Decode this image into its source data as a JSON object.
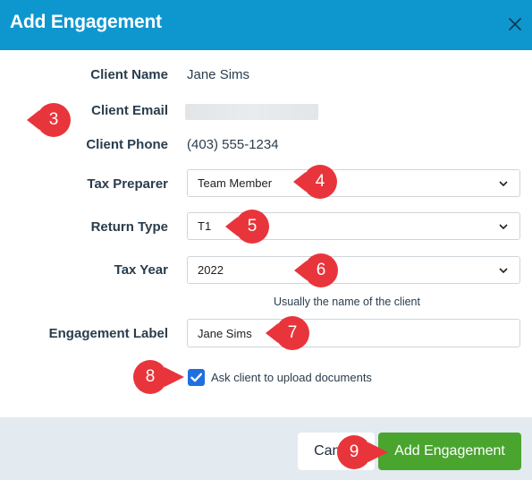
{
  "dialog": {
    "title": "Add Engagement"
  },
  "fields": {
    "client_name_label": "Client Name",
    "client_name_value": "Jane Sims",
    "client_email_label": "Client Email",
    "client_phone_label": "Client Phone",
    "client_phone_value": "(403) 555-1234",
    "tax_preparer_label": "Tax Preparer",
    "tax_preparer_value": "Team Member",
    "return_type_label": "Return Type",
    "return_type_value": "T1",
    "tax_year_label": "Tax Year",
    "tax_year_value": "2022",
    "engagement_hint": "Usually the name of the client",
    "engagement_label_label": "Engagement Label",
    "engagement_label_value": "Jane Sims",
    "upload_checkbox_label": "Ask client to upload documents",
    "upload_checkbox_checked": true
  },
  "footer": {
    "cancel_label": "Cancel",
    "submit_label": "Add Engagement"
  },
  "callouts": [
    "3",
    "4",
    "5",
    "6",
    "7",
    "8",
    "9"
  ],
  "colors": {
    "header": "#0e97cf",
    "primary_button": "#4aa52e",
    "checkbox": "#1f6fe0",
    "callout": "#e8353b",
    "footer": "#e3eaf0"
  },
  "icons": {
    "close": "close-icon",
    "chevron": "chevron-down-icon",
    "check": "checkmark-icon"
  }
}
